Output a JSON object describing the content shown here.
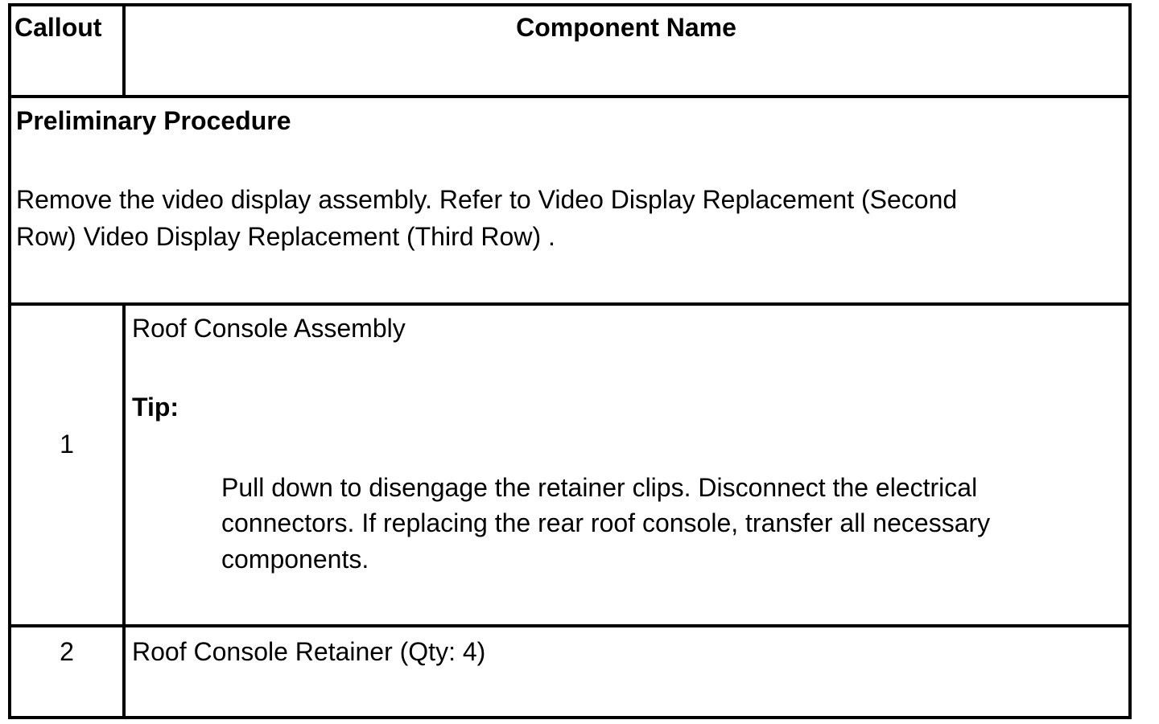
{
  "table": {
    "headers": {
      "callout": "Callout",
      "component_name": "Component Name"
    },
    "preliminary": {
      "title": "Preliminary Procedure",
      "line1": "Remove the video display assembly. Refer to Video Display Replacement (Second",
      "line2": "Row) Video Display Replacement (Third Row) ."
    },
    "rows": [
      {
        "callout": "1",
        "name": "Roof Console Assembly",
        "tip_label": "Tip:",
        "tip_line1": "Pull down to disengage the retainer clips. Disconnect the electrical",
        "tip_line2": "connectors. If replacing the rear roof console, transfer all necessary",
        "tip_line3": "components."
      },
      {
        "callout": "2",
        "name": "Roof Console Retainer (Qty: 4)"
      }
    ]
  }
}
